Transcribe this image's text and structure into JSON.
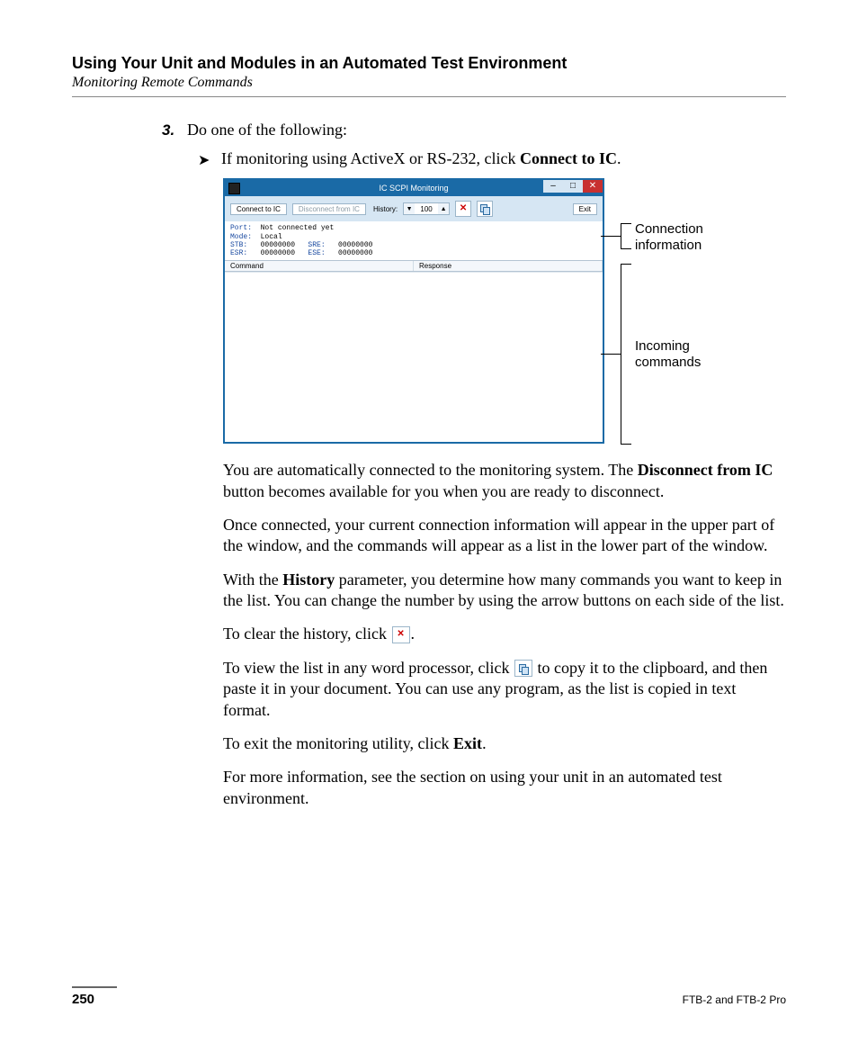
{
  "header": {
    "chapter": "Using Your Unit and Modules in an Automated Test Environment",
    "section": "Monitoring Remote Commands"
  },
  "step": {
    "number": "3.",
    "text": "Do one of the following:"
  },
  "bullet": {
    "prefix": "If monitoring using ActiveX or RS-232, click ",
    "bold": "Connect to IC",
    "suffix": "."
  },
  "app": {
    "title": "IC SCPI Monitoring",
    "buttons": {
      "connect": "Connect to IC",
      "disconnect": "Disconnect from IC",
      "history_label": "History:",
      "history_value": "100",
      "exit": "Exit"
    },
    "conn": {
      "port_lbl": "Port:",
      "port_val": "Not connected yet",
      "mode_lbl": "Mode:",
      "mode_val": "Local",
      "stb_lbl": "STB:",
      "stb_val": "00000000",
      "sre_lbl": "SRE:",
      "sre_val": "00000000",
      "esr_lbl": "ESR:",
      "esr_val": "00000000",
      "ese_lbl": "ESE:",
      "ese_val": "00000000"
    },
    "cols": {
      "command": "Command",
      "response": "Response"
    }
  },
  "callouts": {
    "conn": "Connection information",
    "incoming": "Incoming commands"
  },
  "body": {
    "p1a": "You are automatically connected to the monitoring system. The ",
    "p1b": "Disconnect from IC",
    "p1c": " button becomes available for you when you are ready to disconnect.",
    "p2": "Once connected, your current connection information will appear in the upper part of the window, and the commands will appear as a list in the lower part of the window.",
    "p3a": "With the ",
    "p3b": "History",
    "p3c": " parameter, you determine how many commands you want to keep in the list. You can change the number by using the arrow buttons on each side of the list.",
    "p4a": "To clear the history, click ",
    "p4b": ".",
    "p5a": "To view the list in any word processor, click ",
    "p5b": " to copy it to the clipboard, and then paste it in your document. You can use any program, as the list is copied in text format.",
    "p6a": "To exit the monitoring utility, click ",
    "p6b": "Exit",
    "p6c": ".",
    "p7": "For more information, see the section on using your unit in an automated test environment."
  },
  "footer": {
    "page": "250",
    "product": "FTB-2 and FTB-2 Pro"
  }
}
